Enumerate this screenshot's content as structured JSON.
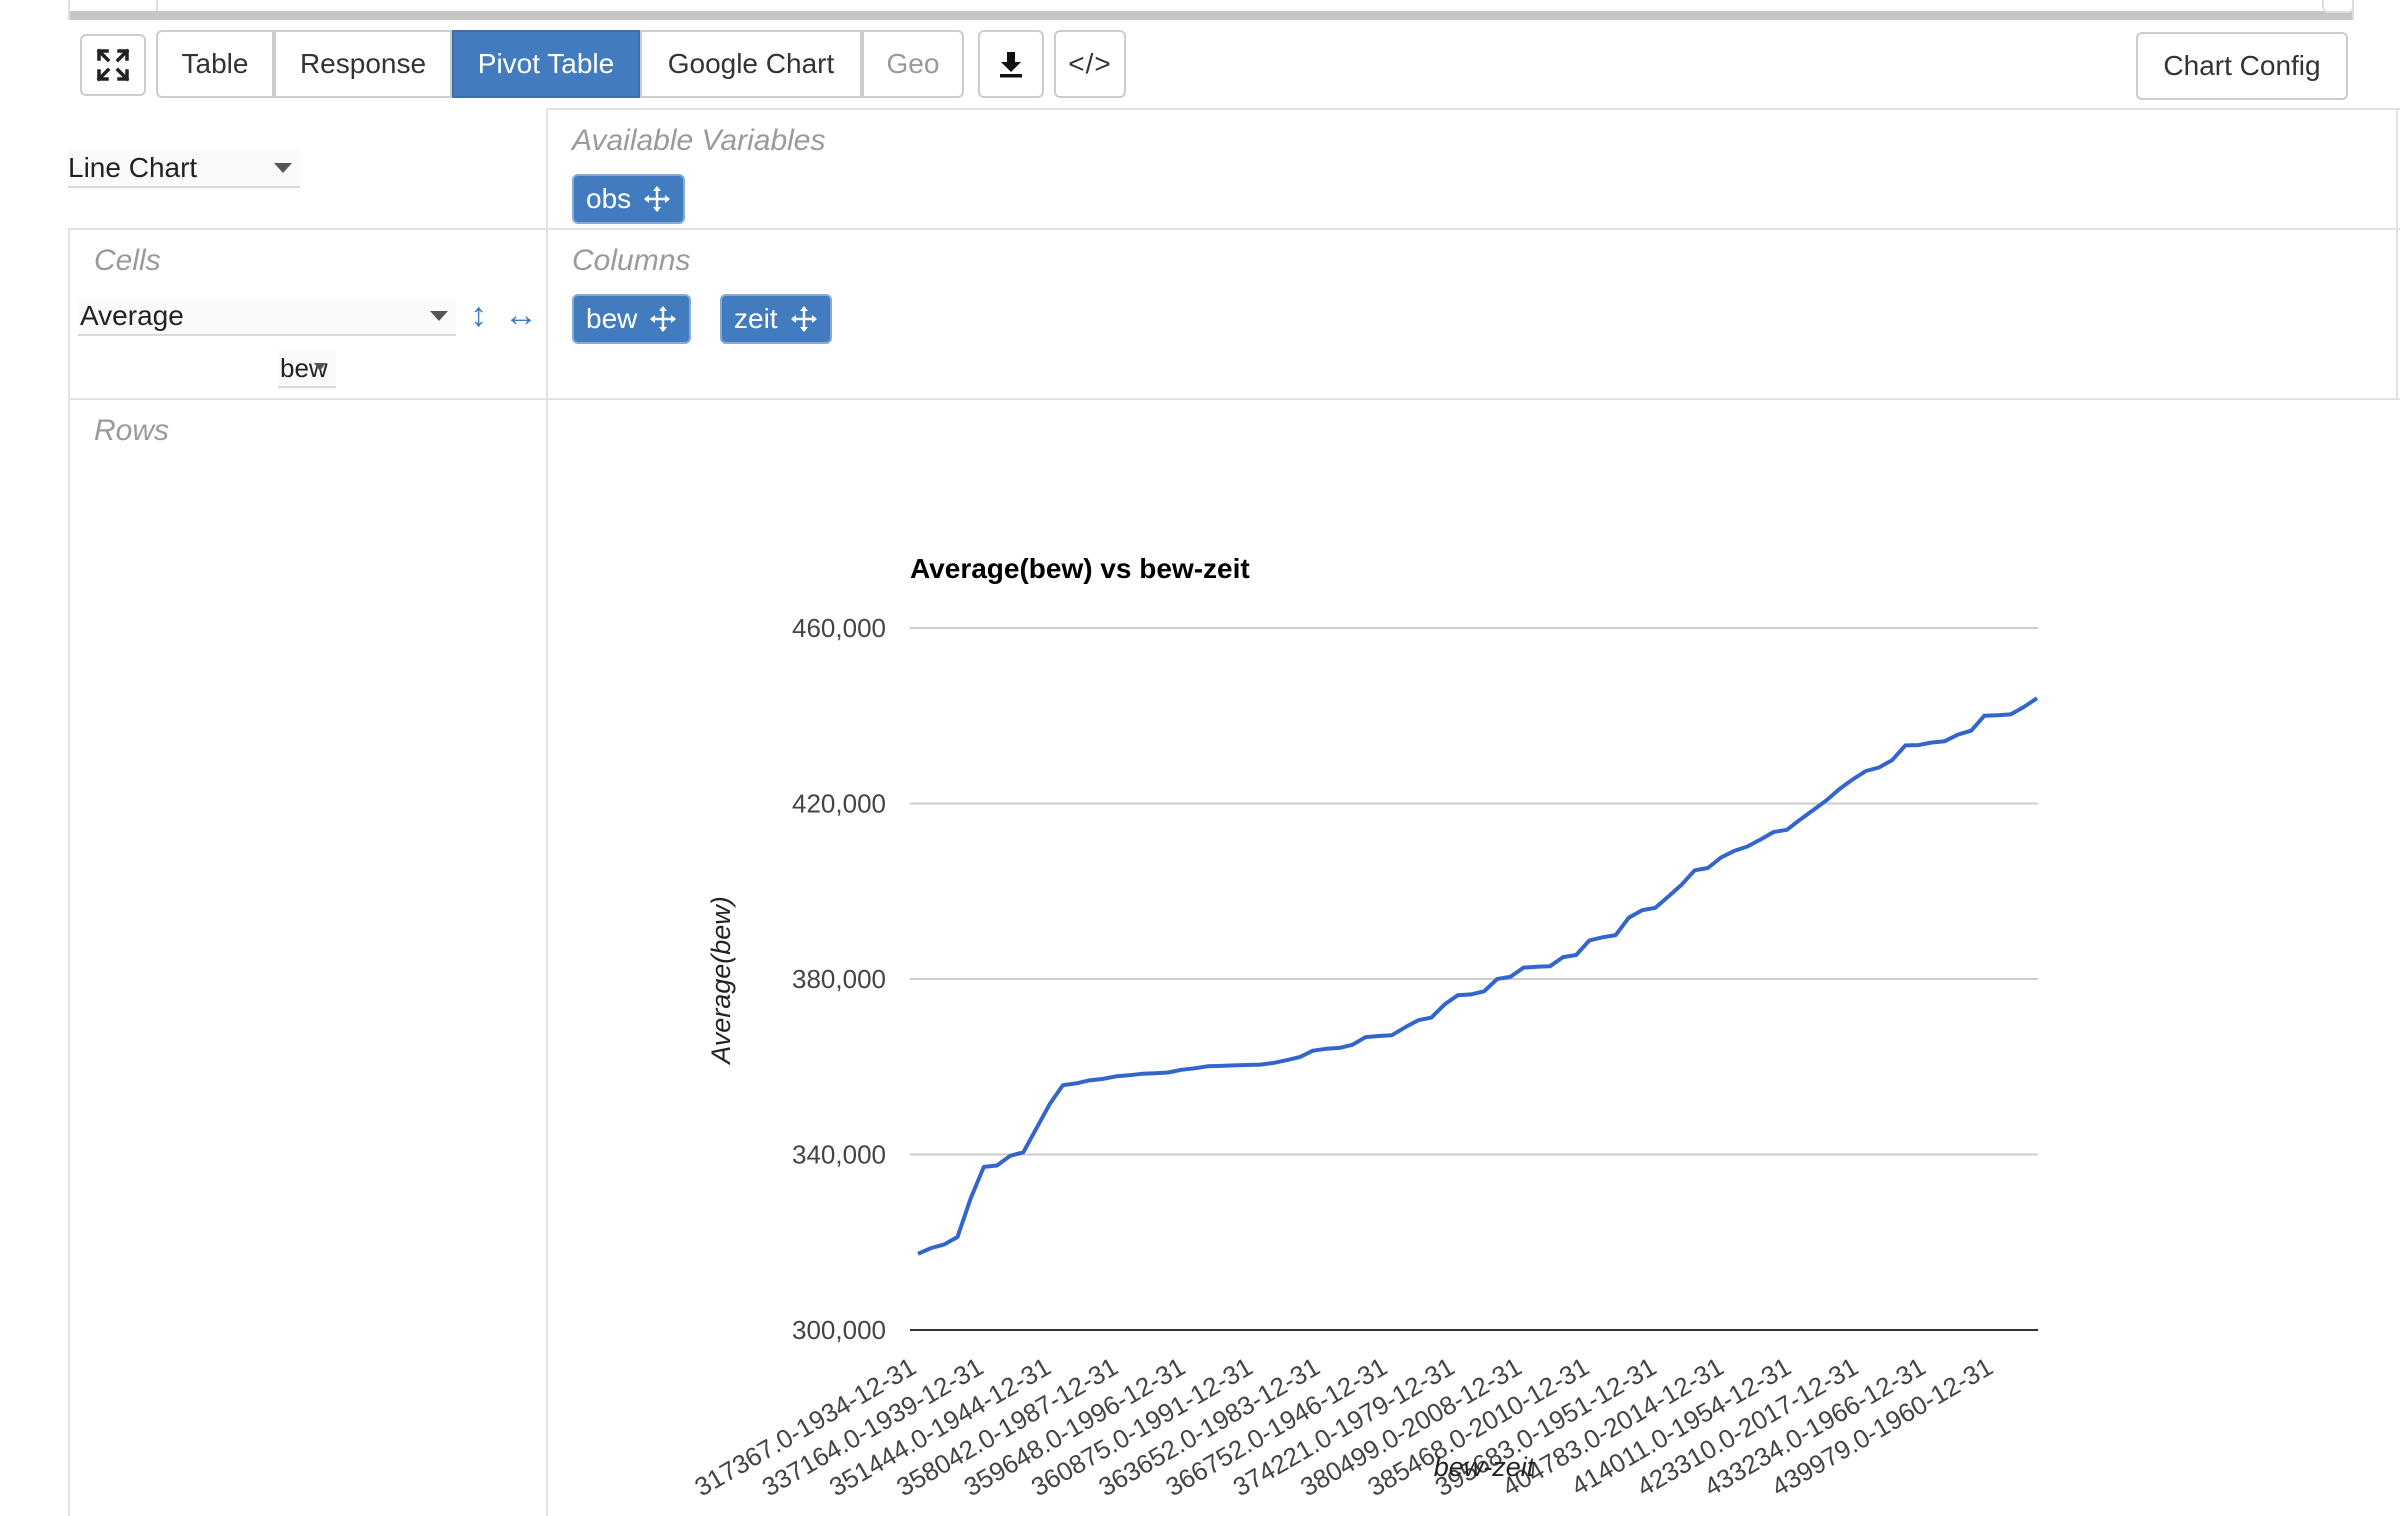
{
  "toolbar": {
    "fullscreen_icon": "expand-icon",
    "tabs": [
      {
        "label": "Table",
        "state": "normal"
      },
      {
        "label": "Response",
        "state": "normal"
      },
      {
        "label": "Pivot Table",
        "state": "active"
      },
      {
        "label": "Google Chart",
        "state": "normal"
      },
      {
        "label": "Geo",
        "state": "disabled"
      }
    ],
    "download_icon": "download-icon",
    "code_label": "</>",
    "chart_config_label": "Chart Config"
  },
  "pivot": {
    "renderer_select": "Line Chart",
    "available_variables_label": "Available Variables",
    "available_variables": [
      "obs"
    ],
    "cells_label": "Cells",
    "aggregator_select": "Average",
    "aggregator_attribute": "bew",
    "columns_label": "Columns",
    "columns": [
      "bew",
      "zeit"
    ],
    "rows_label": "Rows",
    "sort_vertical_icon": "↕",
    "sort_horizontal_icon": "↔"
  },
  "colors": {
    "accent": "#427cbf",
    "line": "#3366cc",
    "grid": "#cccccc"
  },
  "chart_data": {
    "type": "line",
    "title": "Average(bew) vs bew-zeit",
    "ylabel": "Average(bew)",
    "xlabel": "bew-zeit",
    "ylim": [
      300000,
      460000
    ],
    "yticks": [
      "300,000",
      "340,000",
      "380,000",
      "420,000",
      "460,000"
    ],
    "grid": true,
    "tick_labels": [
      "317367.0-1934-12-31",
      "337164.0-1939-12-31",
      "351444.0-1944-12-31",
      "358042.0-1987-12-31",
      "359648.0-1996-12-31",
      "360875.0-1991-12-31",
      "363652.0-1983-12-31",
      "366752.0-1946-12-31",
      "374221.0-1979-12-31",
      "380499.0-2008-12-31",
      "385468.0-2010-12-31",
      "395683.0-1951-12-31",
      "404783.0-2014-12-31",
      "414011.0-1954-12-31",
      "423310.0-2017-12-31",
      "433234.0-1966-12-31",
      "439979.0-1960-12-31"
    ],
    "series": [
      {
        "values": [
          317367,
          318700,
          319500,
          321200,
          330000,
          337164,
          337500,
          339700,
          340500,
          346000,
          351444,
          355800,
          356200,
          356900,
          357200,
          357800,
          358042,
          358400,
          358500,
          358700,
          359300,
          359648,
          360100,
          360200,
          360300,
          360400,
          360500,
          360875,
          361500,
          362200,
          363652,
          364100,
          364300,
          365000,
          366752,
          367000,
          367200,
          369000,
          370600,
          371200,
          374221,
          376300,
          376500,
          377200,
          380000,
          380499,
          382600,
          382800,
          382900,
          385000,
          385468,
          388800,
          389500,
          390000,
          394000,
          395683,
          396200,
          398800,
          401500,
          404783,
          405300,
          407700,
          409200,
          410200,
          411800,
          413500,
          414011,
          416300,
          418500,
          420700,
          423310,
          425500,
          427400,
          428200,
          429900,
          433234,
          433300,
          433900,
          434200,
          435700,
          436600,
          439979,
          440100,
          440300,
          442000,
          444000
        ]
      }
    ]
  }
}
